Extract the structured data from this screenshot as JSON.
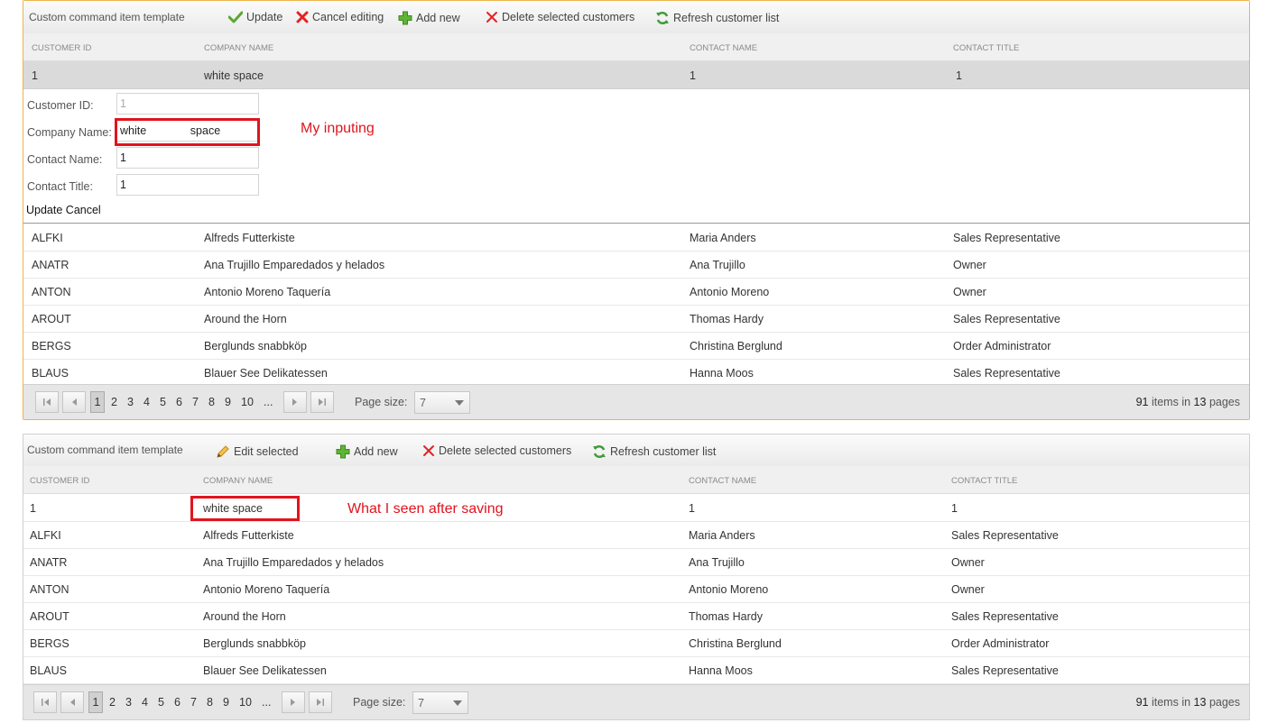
{
  "grid1": {
    "toolbar": {
      "title": "Custom command item template",
      "update": "Update",
      "cancel_editing": "Cancel editing",
      "add_new": "Add new",
      "delete_selected": "Delete selected customers",
      "refresh": "Refresh customer list"
    },
    "columns": [
      "CUSTOMER ID",
      "COMPANY NAME",
      "CONTACT NAME",
      "CONTACT TITLE"
    ],
    "edited_row": [
      "1",
      "white space",
      "1",
      "1"
    ],
    "form": {
      "customer_id_label": "Customer ID:",
      "customer_id_value": "1",
      "company_name_label": "Company Name:",
      "company_name_value": "white              space",
      "contact_name_label": "Contact Name:",
      "contact_name_value": "1",
      "contact_title_label": "Contact Title:",
      "contact_title_value": "1",
      "update_link": "Update",
      "cancel_link": "Cancel"
    },
    "rows": [
      [
        "ALFKI",
        "Alfreds Futterkiste",
        "Maria Anders",
        "Sales Representative"
      ],
      [
        "ANATR",
        "Ana Trujillo Emparedados y helados",
        "Ana Trujillo",
        "Owner"
      ],
      [
        "ANTON",
        "Antonio Moreno Taquería",
        "Antonio Moreno",
        "Owner"
      ],
      [
        "AROUT",
        "Around the Horn",
        "Thomas Hardy",
        "Sales Representative"
      ],
      [
        "BERGS",
        "Berglunds snabbköp",
        "Christina Berglund",
        "Order Administrator"
      ],
      [
        "BLAUS",
        "Blauer See Delikatessen",
        "Hanna Moos",
        "Sales Representative"
      ]
    ],
    "pager": {
      "pages": [
        "1",
        "2",
        "3",
        "4",
        "5",
        "6",
        "7",
        "8",
        "9",
        "10",
        "..."
      ],
      "page_size_label": "Page size:",
      "page_size_value": "7",
      "total_items": "91",
      "items_in": "items in",
      "total_pages": "13",
      "pages_word": "pages"
    }
  },
  "grid2": {
    "toolbar": {
      "title": "Custom command item template",
      "edit_selected": "Edit selected",
      "add_new": "Add new",
      "delete_selected": "Delete selected customers",
      "refresh": "Refresh customer list"
    },
    "columns": [
      "CUSTOMER ID",
      "COMPANY NAME",
      "CONTACT NAME",
      "CONTACT TITLE"
    ],
    "rows": [
      [
        "1",
        "white space",
        "1",
        "1"
      ],
      [
        "ALFKI",
        "Alfreds Futterkiste",
        "Maria Anders",
        "Sales Representative"
      ],
      [
        "ANATR",
        "Ana Trujillo Emparedados y helados",
        "Ana Trujillo",
        "Owner"
      ],
      [
        "ANTON",
        "Antonio Moreno Taquería",
        "Antonio Moreno",
        "Owner"
      ],
      [
        "AROUT",
        "Around the Horn",
        "Thomas Hardy",
        "Sales Representative"
      ],
      [
        "BERGS",
        "Berglunds snabbköp",
        "Christina Berglund",
        "Order Administrator"
      ],
      [
        "BLAUS",
        "Blauer See Delikatessen",
        "Hanna Moos",
        "Sales Representative"
      ]
    ],
    "pager": {
      "pages": [
        "1",
        "2",
        "3",
        "4",
        "5",
        "6",
        "7",
        "8",
        "9",
        "10",
        "..."
      ],
      "page_size_label": "Page size:",
      "page_size_value": "7",
      "total_items": "91",
      "items_in": "items in",
      "total_pages": "13",
      "pages_word": "pages"
    }
  },
  "annotations": {
    "my_inputting": "My inputing",
    "after_saving": "What I seen after saving"
  },
  "colors": {
    "highlight": "#e0141e",
    "active_border": "#ecb54a"
  },
  "icons": [
    "check-icon",
    "red-x-icon",
    "green-plus-icon",
    "refresh-icon",
    "pencil-icon",
    "first-page-icon",
    "prev-page-icon",
    "next-page-icon",
    "last-page-icon",
    "dropdown-arrow-icon"
  ]
}
